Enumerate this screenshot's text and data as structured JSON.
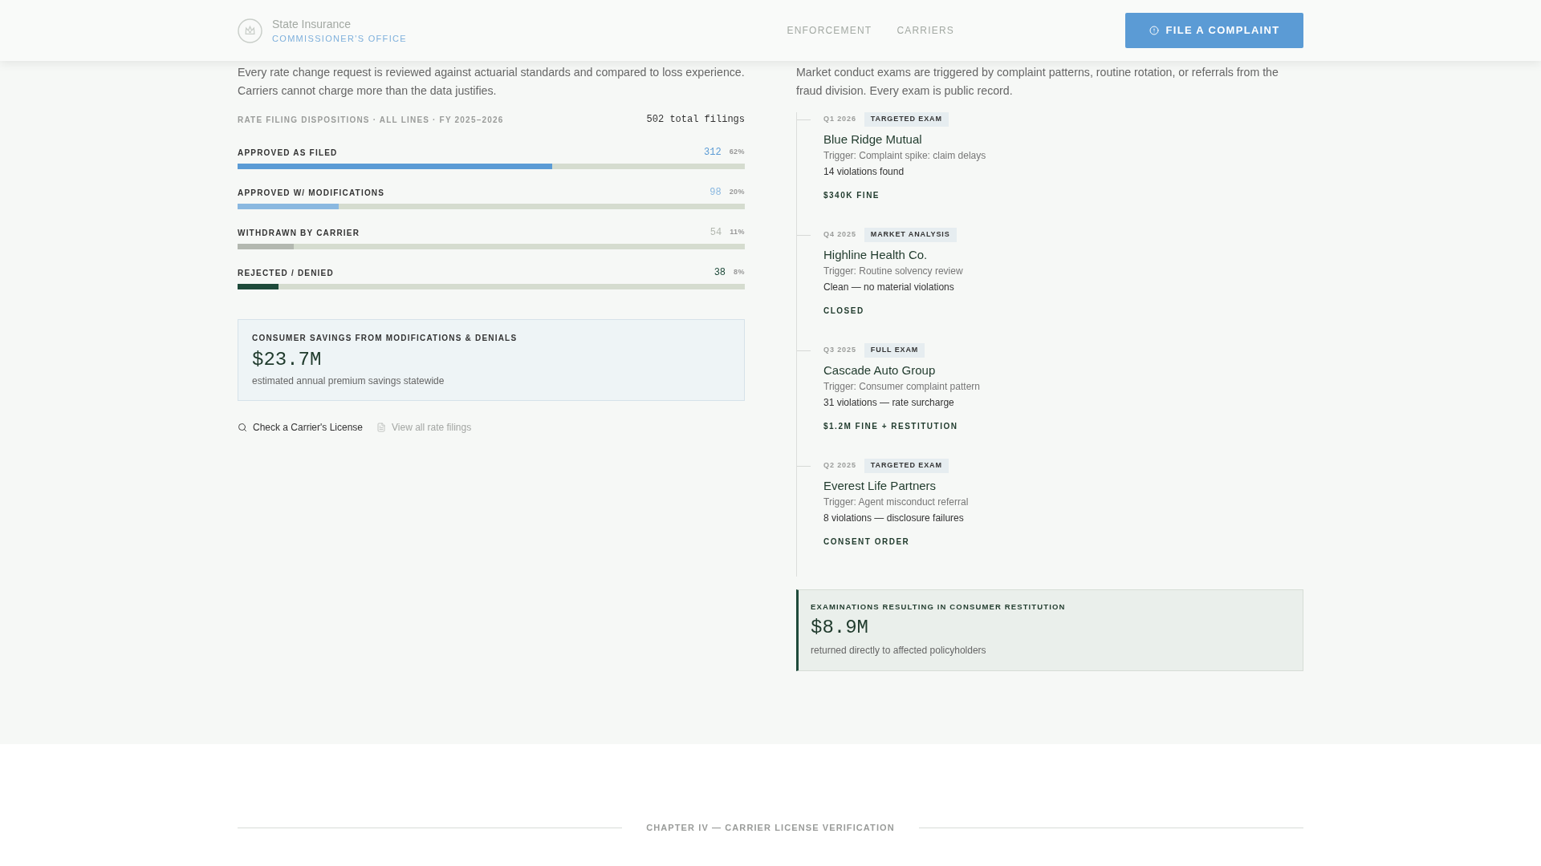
{
  "header": {
    "title": "State Insurance",
    "subtitle": "COMMISSIONER'S OFFICE",
    "nav": [
      {
        "label": "ENFORCEMENT"
      },
      {
        "label": "CARRIERS"
      }
    ],
    "cta": "FILE A COMPLAINT"
  },
  "rate_filings": {
    "intro": "Every rate change request is reviewed against actuarial standards and compared to loss experience. Carriers cannot charge more than the data justifies.",
    "chart_title": "RATE FILING DISPOSITIONS · ALL LINES · FY 2025–2026",
    "total": "502 total filings",
    "rows": [
      {
        "label": "APPROVED AS FILED",
        "count": "312",
        "percent": "62%",
        "level": 0.62,
        "color": "#5b9bd5"
      },
      {
        "label": "APPROVED W/ MODIFICATIONS",
        "count": "98",
        "percent": "20%",
        "level": 0.2,
        "color": "#8ab8e0"
      },
      {
        "label": "WITHDRAWN BY CARRIER",
        "count": "54",
        "percent": "11%",
        "level": 0.11,
        "color": "#b3b8b0"
      },
      {
        "label": "REJECTED / DENIED",
        "count": "38",
        "percent": "8%",
        "level": 0.08,
        "color": "#1e4a3a"
      }
    ],
    "savings": {
      "title": "CONSUMER SAVINGS FROM MODIFICATIONS & DENIALS",
      "amount": "$23.7M",
      "note": "estimated annual premium savings statewide"
    },
    "links": [
      {
        "label": "Check a Carrier's License",
        "kind": "search",
        "disabled": false
      },
      {
        "label": "View all rate filings",
        "kind": "document",
        "disabled": true
      }
    ]
  },
  "market_conduct": {
    "intro": "Market conduct exams are triggered by complaint patterns, routine rotation, or referrals from the fraud division. Every exam is public record.",
    "exams": [
      {
        "date": "Q1 2026",
        "type": "TARGETED EXAM",
        "carrier": "Blue Ridge Mutual",
        "trigger": "Trigger: Complaint spike: claim delays",
        "result": "14 violations found",
        "outcome": "$340K FINE"
      },
      {
        "date": "Q4 2025",
        "type": "MARKET ANALYSIS",
        "carrier": "Highline Health Co.",
        "trigger": "Trigger: Routine solvency review",
        "result": "Clean — no material violations",
        "outcome": "CLOSED"
      },
      {
        "date": "Q3 2025",
        "type": "FULL EXAM",
        "carrier": "Cascade Auto Group",
        "trigger": "Trigger: Consumer complaint pattern",
        "result": "31 violations — rate surcharge",
        "outcome": "$1.2M FINE + RESTITUTION"
      },
      {
        "date": "Q2 2025",
        "type": "TARGETED EXAM",
        "carrier": "Everest Life Partners",
        "trigger": "Trigger: Agent misconduct referral",
        "result": "8 violations — disclosure failures",
        "outcome": "CONSENT ORDER"
      }
    ],
    "restitution": {
      "title": "EXAMINATIONS RESULTING IN CONSUMER RESTITUTION",
      "amount": "$8.9M",
      "note": "returned directly to affected policyholders"
    }
  },
  "next_chapter": "CHAPTER IV — CARRIER LICENSE VERIFICATION"
}
